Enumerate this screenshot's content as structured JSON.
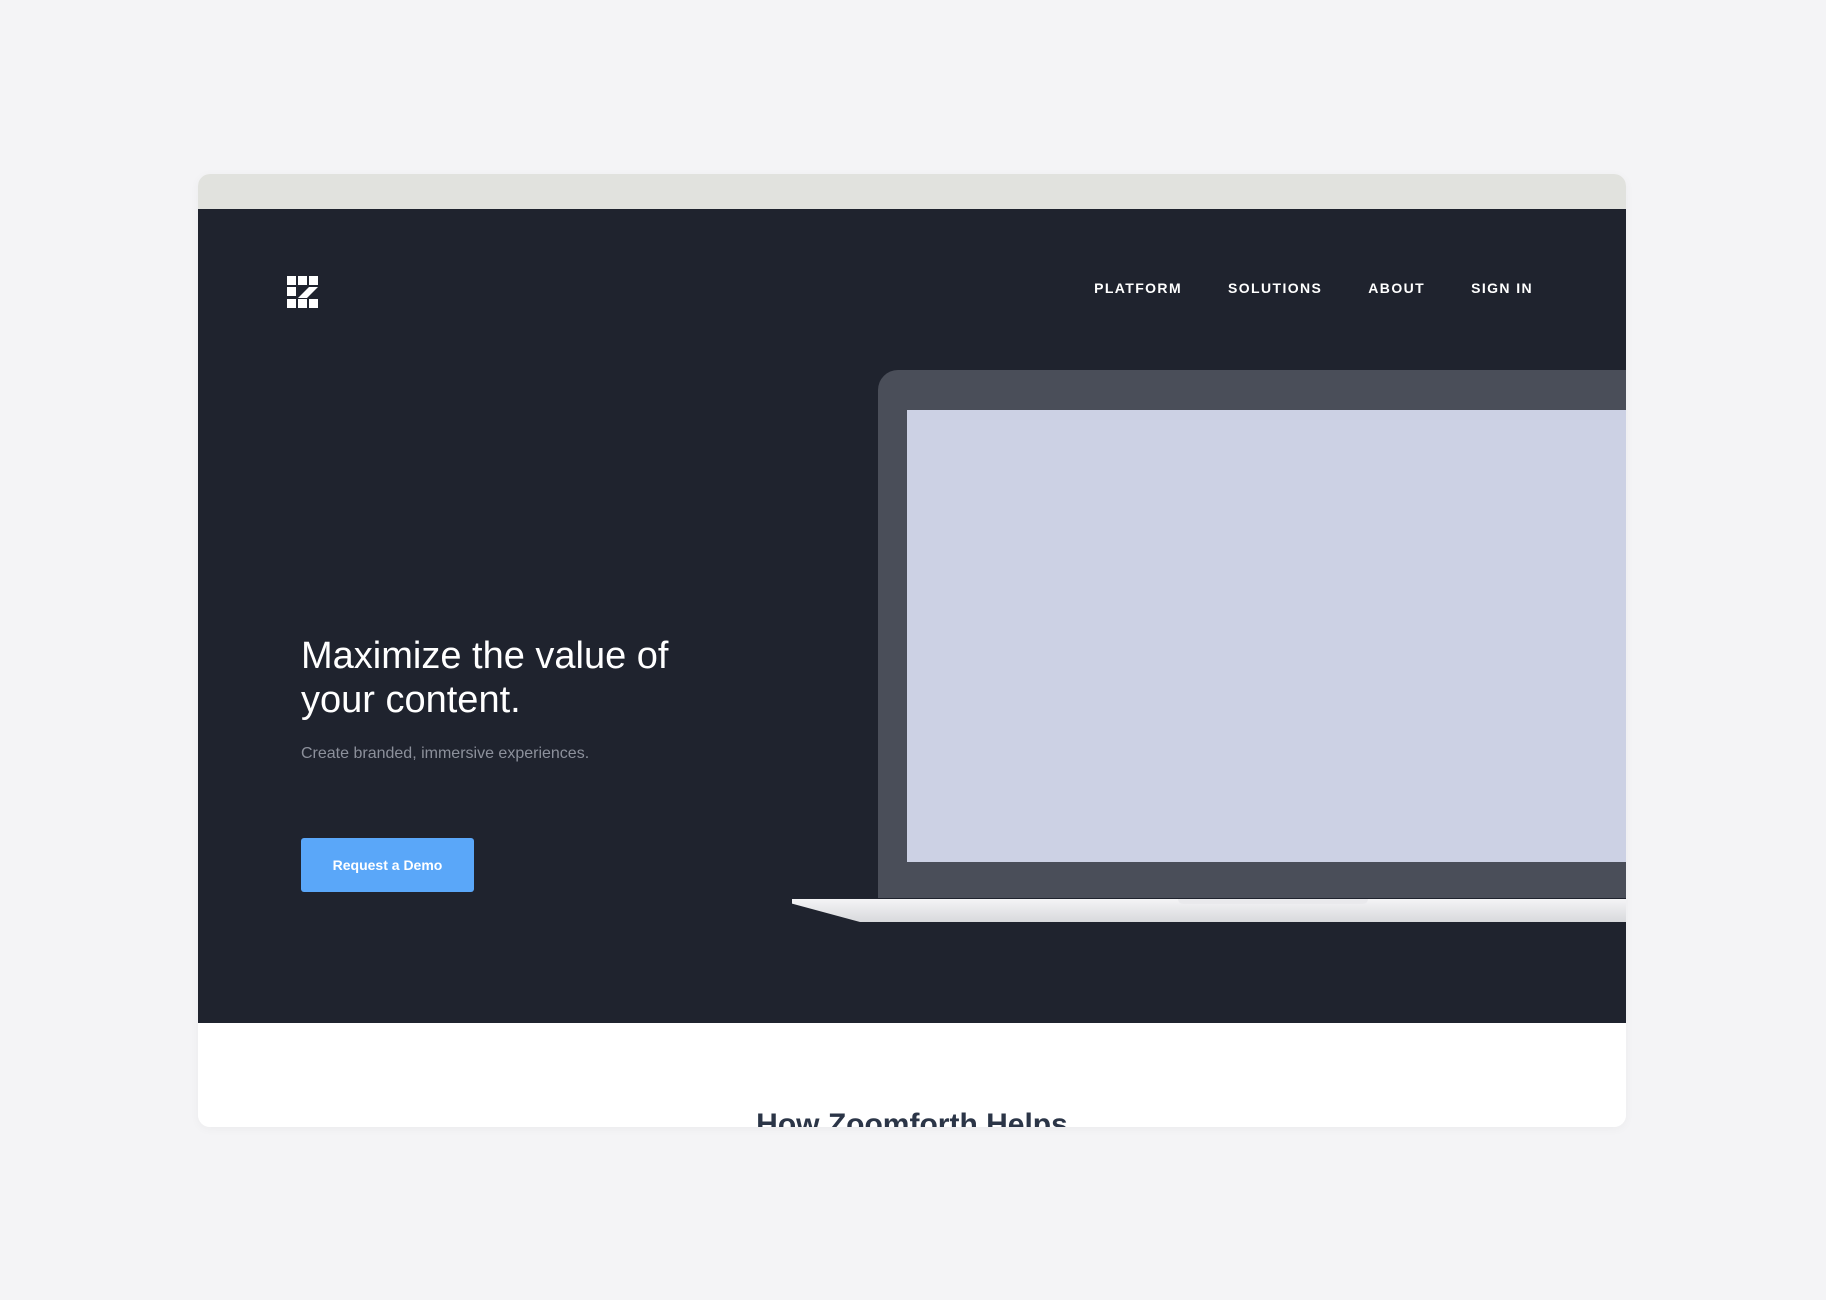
{
  "brand": {
    "logo_icon": "zoomforth-logo-icon"
  },
  "nav": {
    "items": [
      {
        "label": "PLATFORM"
      },
      {
        "label": "SOLUTIONS"
      },
      {
        "label": "ABOUT"
      },
      {
        "label": "SIGN IN"
      }
    ]
  },
  "hero": {
    "headline": "Maximize the value of your content.",
    "subheadline": "Create branded, immersive experiences.",
    "cta_label": "Request a Demo"
  },
  "section": {
    "title": "How Zoomforth Helps"
  },
  "colors": {
    "page_bg": "#f4f4f6",
    "hero_bg": "#1f232e",
    "accent": "#5aa7f9",
    "screen": "#ccd1e4",
    "chrome_bar": "#e1e2de"
  }
}
